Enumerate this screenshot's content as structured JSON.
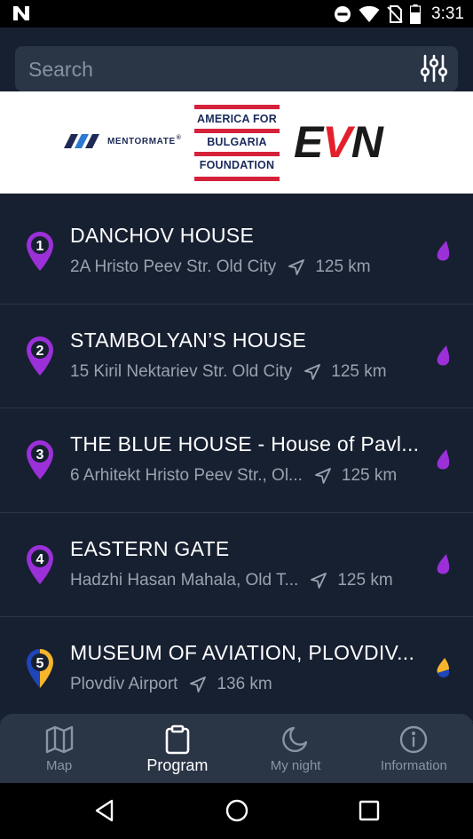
{
  "status_bar": {
    "time": "3:31",
    "icons": [
      "app-n-icon",
      "do-not-disturb-icon",
      "wifi-icon",
      "no-sim-icon",
      "battery-icon"
    ]
  },
  "search": {
    "placeholder": "Search",
    "filter_icon": "sliders-icon"
  },
  "sponsors": {
    "mentormate": "MENTORMATE",
    "mentormate_tm": "®",
    "abf_lines": [
      "AMERICA FOR",
      "BULGARIA",
      "FOUNDATION"
    ],
    "evn_e": "E",
    "evn_v": "V",
    "evn_n": "N"
  },
  "colors": {
    "background": "#172031",
    "card": "#2a3546",
    "accent_purple": "#9b30d9",
    "accent_yellow": "#f7b52c",
    "accent_blue": "#1f46b8"
  },
  "places": [
    {
      "number": "1",
      "title": "DANCHOV HOUSE",
      "address": "2A Hristo Peev Str. Old City",
      "distance": "125 km",
      "pin": "purple"
    },
    {
      "number": "2",
      "title": "STAMBOLYAN’S HOUSE",
      "address": "15 Kiril Nektariev Str. Old City",
      "distance": "125 km",
      "pin": "purple"
    },
    {
      "number": "3",
      "title": "THE BLUE HOUSE - House of Pavl...",
      "address": "6 Arhitekt Hristo Peev Str., Ol...",
      "distance": "125 km",
      "pin": "purple"
    },
    {
      "number": "4",
      "title": "EASTERN GATE",
      "address": "Hadzhi Hasan Mahala, Old T...",
      "distance": "125 km",
      "pin": "purple"
    },
    {
      "number": "5",
      "title": "MUSEUM OF AVIATION, PLOVDIV...",
      "address": "Plovdiv Airport",
      "distance": "136 km",
      "pin": "yellow-blue"
    }
  ],
  "tabs": [
    {
      "label": "Map",
      "icon": "map-icon",
      "active": false
    },
    {
      "label": "Program",
      "icon": "clipboard-icon",
      "active": true
    },
    {
      "label": "My night",
      "icon": "moon-icon",
      "active": false
    },
    {
      "label": "Information",
      "icon": "info-icon",
      "active": false
    }
  ],
  "nav_bar": {
    "icons": [
      "back-icon",
      "home-icon",
      "recents-icon"
    ]
  }
}
